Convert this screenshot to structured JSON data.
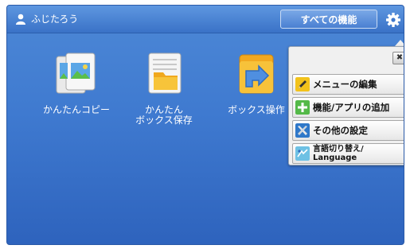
{
  "header": {
    "user_name": "ふじたろう",
    "all_functions_label": "すべての機能"
  },
  "apps": [
    {
      "label_line1": "かんたんコピー",
      "label_line2": ""
    },
    {
      "label_line1": "かんたん",
      "label_line2": "ボックス保存"
    },
    {
      "label_line1": "ボックス操作",
      "label_line2": ""
    }
  ],
  "settings_menu": {
    "items": [
      {
        "label": "メニューの編集"
      },
      {
        "label": "機能/アプリの追加"
      },
      {
        "label": "その他の設定"
      },
      {
        "label_line1": "言語切り替え/",
        "label_line2": "Language"
      }
    ]
  },
  "colors": {
    "background_top": "#4d88d6",
    "background_bottom": "#2e63bd",
    "panel": "#f0f0f0"
  }
}
